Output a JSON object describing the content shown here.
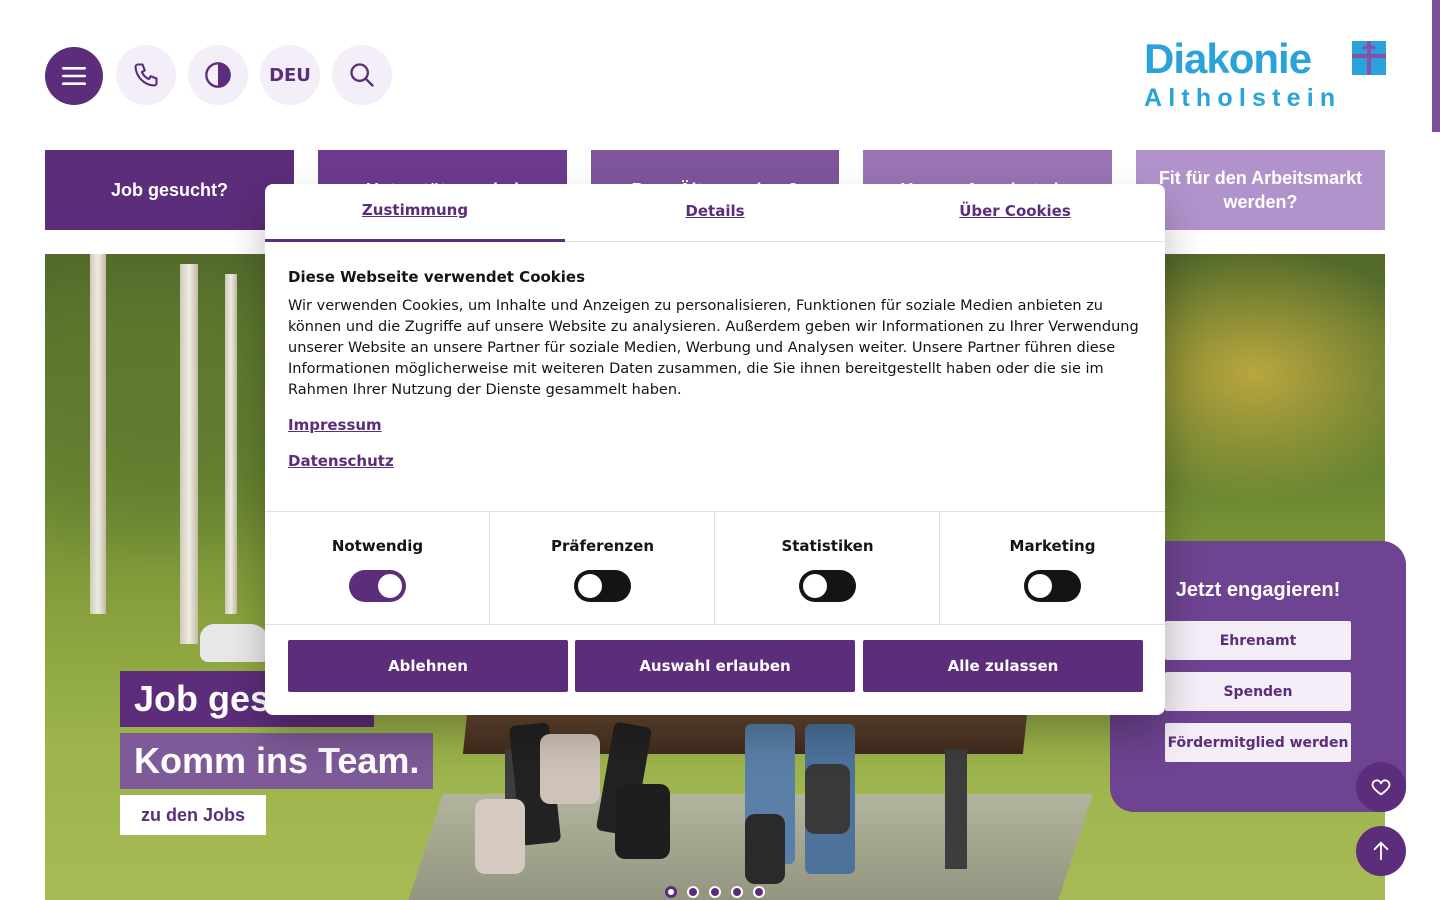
{
  "header": {
    "menu_icon": "hamburger-icon",
    "phone_icon": "phone-icon",
    "contrast_icon": "contrast-icon",
    "language": "DEU",
    "search_icon": "search-icon",
    "logo_top": "Diakonie",
    "logo_bottom": "Altholstein",
    "logo_icon": "diakonie-cross-icon"
  },
  "nav_tiles": [
    {
      "label": "Job gesucht?"
    },
    {
      "label": "Unterstützung bei"
    },
    {
      "label": "Pass Älterwerden ?"
    },
    {
      "label": "Unsere Angebote im"
    },
    {
      "label": "Fit für den Arbeitsmarkt werden?"
    }
  ],
  "hero": {
    "headline_1": "Job gesucht?",
    "headline_2": "Komm ins Team.",
    "cta": "zu den Jobs",
    "slides_count": 5,
    "active_slide": 1
  },
  "engage": {
    "title": "Jetzt engagieren!",
    "buttons": [
      "Ehrenamt",
      "Spenden",
      "Fördermitglied werden"
    ],
    "heart_icon": "heart-icon",
    "up_icon": "arrow-up-icon"
  },
  "cookie": {
    "tabs": [
      "Zustimmung",
      "Details",
      "Über Cookies"
    ],
    "active_tab": "Zustimmung",
    "title": "Diese Webseite verwendet Cookies",
    "body": "Wir verwenden Cookies, um Inhalte und Anzeigen zu personalisieren, Funktionen für soziale Medien anbieten zu können und die Zugriffe auf unsere Website zu analysieren. Außerdem geben wir Informationen zu Ihrer Verwendung unserer Website an unsere Partner für soziale Medien, Werbung und Analysen weiter. Unsere Partner führen diese Informationen möglicherweise mit weiteren Daten zusammen, die Sie ihnen bereitgestellt haben oder die sie im Rahmen Ihrer Nutzung der Dienste gesammelt haben.",
    "links": [
      "Impressum",
      "Datenschutz"
    ],
    "categories": [
      {
        "label": "Notwendig",
        "enabled": true
      },
      {
        "label": "Präferenzen",
        "enabled": false
      },
      {
        "label": "Statistiken",
        "enabled": false
      },
      {
        "label": "Marketing",
        "enabled": false
      }
    ],
    "buttons": {
      "reject": "Ablehnen",
      "allow_selection": "Auswahl erlauben",
      "allow_all": "Alle zulassen"
    }
  },
  "colors": {
    "brand_purple": "#5c2d7a",
    "logo_blue": "#2aa2da",
    "light_purple_bg": "#f3eef7"
  }
}
